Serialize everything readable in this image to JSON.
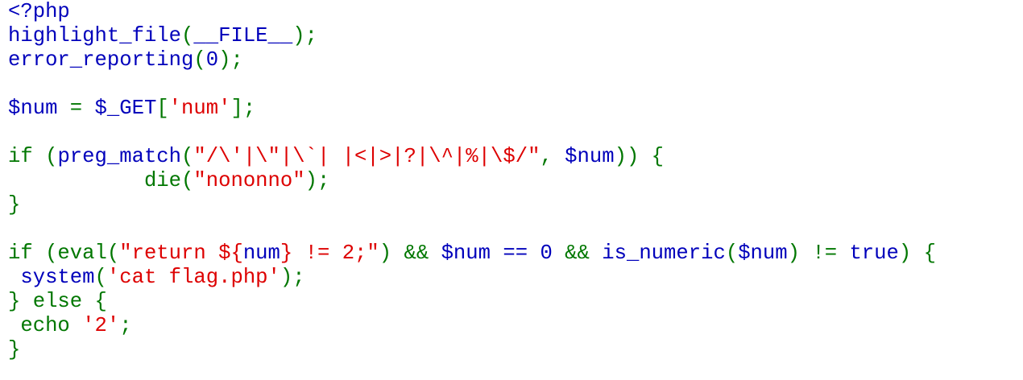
{
  "colors": {
    "default": "#0000BB",
    "keyword": "#007700",
    "string": "#DD0000"
  },
  "code_lines": [
    [
      [
        "d",
        "<?php"
      ]
    ],
    [
      [
        "d",
        "highlight_file"
      ],
      [
        "k",
        "("
      ],
      [
        "d",
        "__FILE__"
      ],
      [
        "k",
        ");"
      ]
    ],
    [
      [
        "d",
        "error_reporting"
      ],
      [
        "k",
        "("
      ],
      [
        "d",
        "0"
      ],
      [
        "k",
        ");"
      ]
    ],
    [],
    [
      [
        "d",
        "$num "
      ],
      [
        "k",
        "= "
      ],
      [
        "d",
        "$_GET"
      ],
      [
        "k",
        "["
      ],
      [
        "s",
        "'num'"
      ],
      [
        "k",
        "];"
      ]
    ],
    [],
    [
      [
        "k",
        "if ("
      ],
      [
        "d",
        "preg_match"
      ],
      [
        "k",
        "("
      ],
      [
        "s",
        "\"/\\'|\\\"|\\`| |<|>|?|\\^|%|\\$/\""
      ],
      [
        "k",
        ", "
      ],
      [
        "d",
        "$num"
      ],
      [
        "k",
        ")) {"
      ]
    ],
    [
      [
        "k",
        "           die("
      ],
      [
        "s",
        "\"nononno\""
      ],
      [
        "k",
        ");"
      ]
    ],
    [
      [
        "k",
        "}"
      ]
    ],
    [],
    [
      [
        "k",
        "if (eval("
      ],
      [
        "s",
        "\"return ${"
      ],
      [
        "d",
        "num"
      ],
      [
        "s",
        "} != 2;\""
      ],
      [
        "k",
        ") && "
      ],
      [
        "d",
        "$num "
      ],
      [
        "d",
        "== 0 "
      ],
      [
        "k",
        "&& "
      ],
      [
        "d",
        "is_numeric"
      ],
      [
        "k",
        "("
      ],
      [
        "d",
        "$num"
      ],
      [
        "k",
        ") != "
      ],
      [
        "d",
        "true"
      ],
      [
        "k",
        ") {"
      ]
    ],
    [
      [
        "k",
        " "
      ],
      [
        "d",
        "system"
      ],
      [
        "k",
        "("
      ],
      [
        "s",
        "'cat flag.php'"
      ],
      [
        "k",
        ");"
      ]
    ],
    [
      [
        "k",
        "} else {"
      ]
    ],
    [
      [
        "k",
        " echo "
      ],
      [
        "s",
        "'2'"
      ],
      [
        "k",
        ";"
      ]
    ],
    [
      [
        "k",
        "}"
      ]
    ]
  ]
}
